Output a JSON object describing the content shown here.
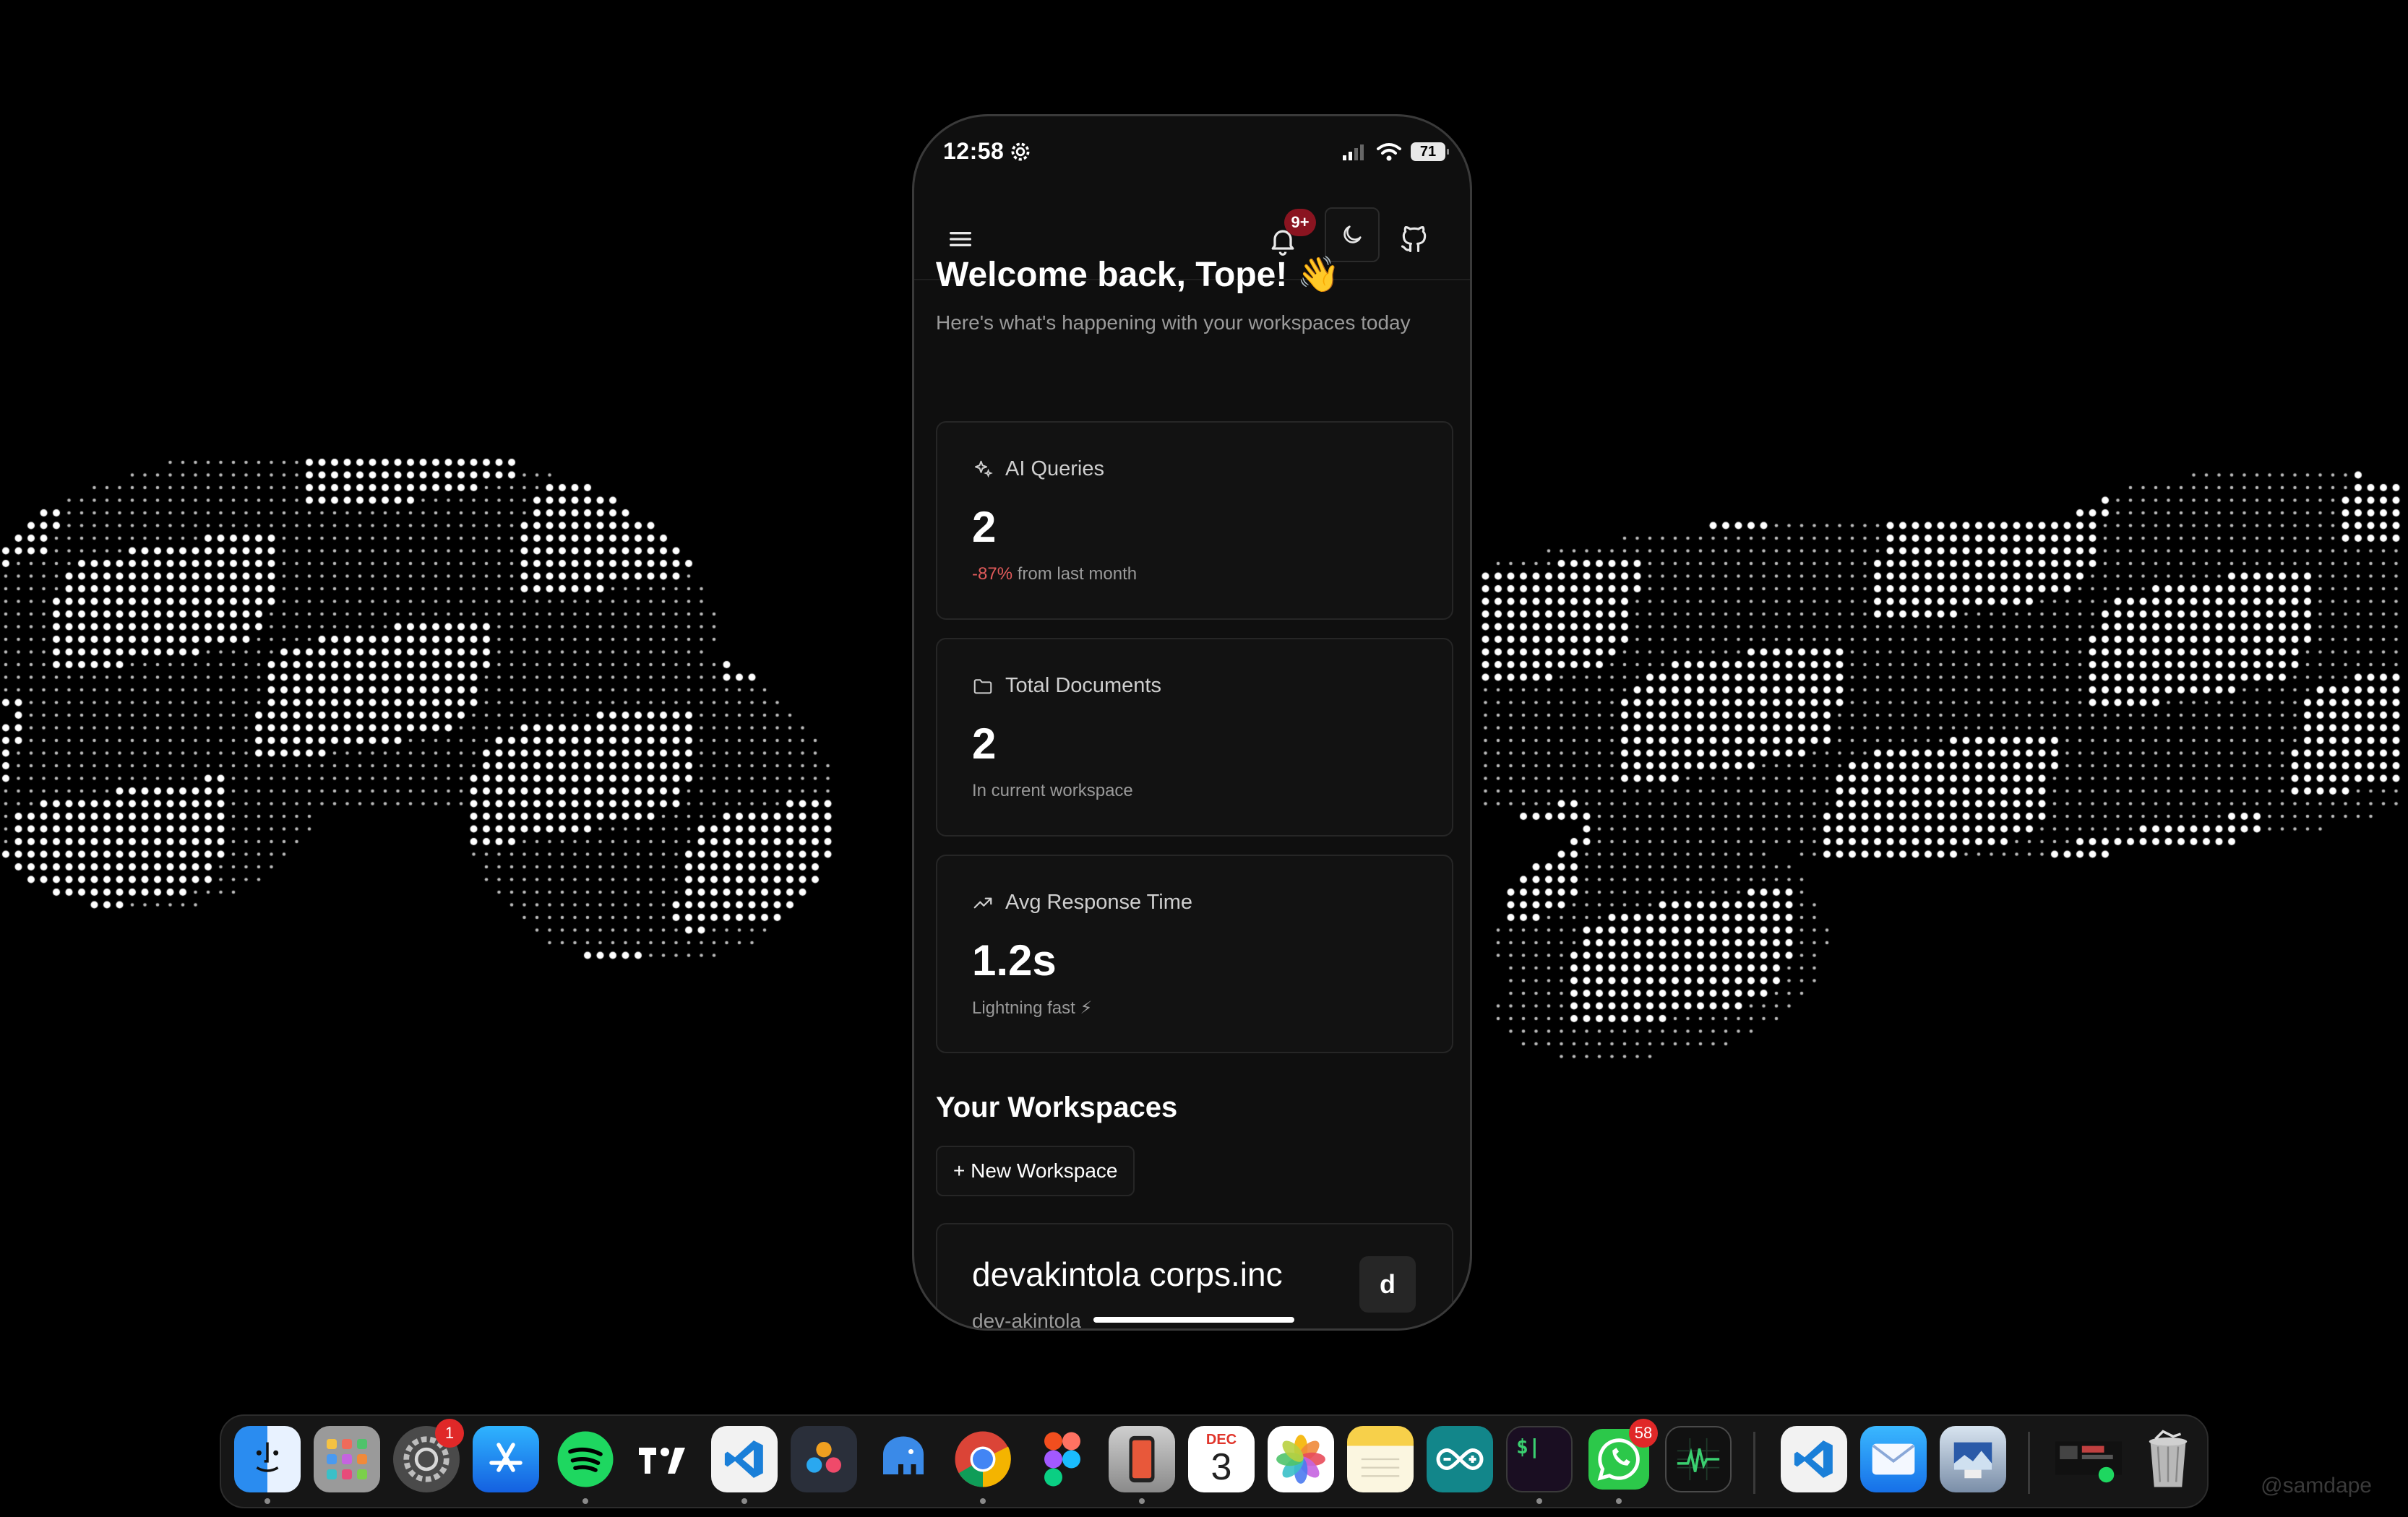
{
  "status_bar": {
    "time": "12:58",
    "battery": "71"
  },
  "app_bar": {
    "notification_badge": "9+"
  },
  "welcome": {
    "title": "Welcome back, Tope! 👋",
    "subtitle": "Here's what's happening with your workspaces today"
  },
  "stats": [
    {
      "label": "AI Queries",
      "value": "2",
      "delta": "-87%",
      "sub": " from last month",
      "icon": "sparkles-icon"
    },
    {
      "label": "Total Documents",
      "value": "2",
      "sub": "In current workspace",
      "icon": "folder-icon"
    },
    {
      "label": "Avg Response Time",
      "value": "1.2s",
      "sub": "Lightning fast ⚡",
      "icon": "trending-up-icon"
    }
  ],
  "workspaces": {
    "title": "Your Workspaces",
    "new_button": "+ New Workspace",
    "items": [
      {
        "name": "devakintola corps.inc",
        "slug": "dev-akintola",
        "initial": "d"
      }
    ]
  },
  "dock": {
    "settings_badge": "1",
    "whatsapp_badge": "58",
    "calendar_month": "DEC",
    "calendar_day": "3",
    "terminal_prompt": "$|"
  },
  "watermark": "@samdape"
}
